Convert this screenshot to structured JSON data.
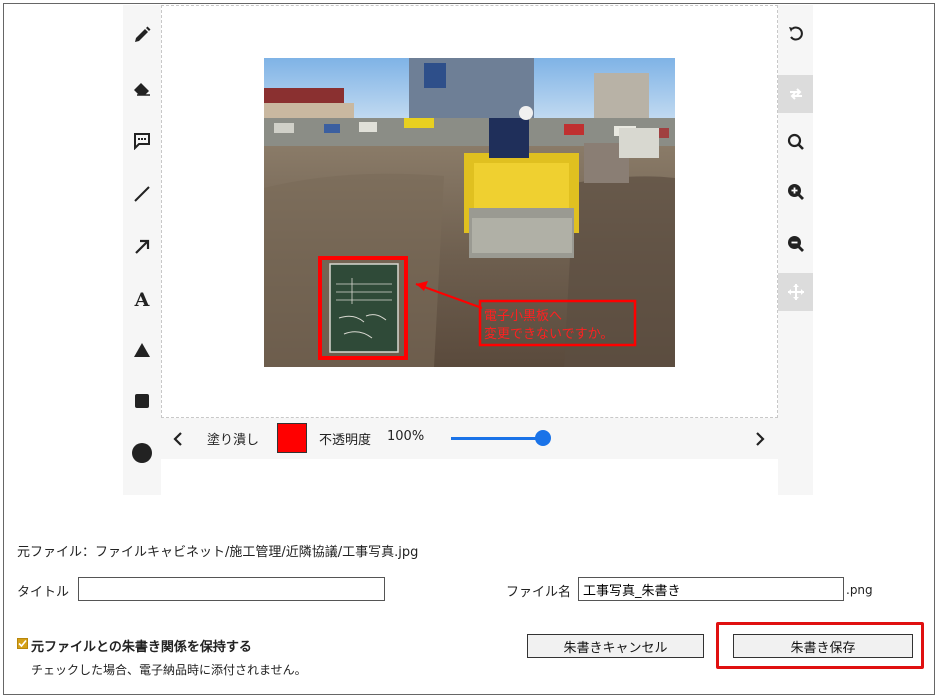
{
  "tools": {
    "left": [
      "pencil-icon",
      "eraser-icon",
      "comment-icon",
      "line-icon",
      "arrow-icon",
      "text-icon",
      "triangle-icon",
      "square-icon",
      "circle-icon"
    ],
    "text_tool_glyph": "A",
    "right": [
      "undo-icon",
      "redo-icon",
      "search-icon",
      "zoom-in-icon",
      "zoom-out-icon",
      "move-icon"
    ]
  },
  "photo": {
    "annotation_text_line1": "電子小黒板へ",
    "annotation_text_line2": "変更できないですか。",
    "annotation_color": "#ff0000"
  },
  "style_bar": {
    "fill_label": "塗り潰し",
    "fill_color": "#ff0000",
    "opacity_label": "不透明度",
    "opacity_value": "100%",
    "opacity_fraction": 1.0,
    "prev_icon": "chevron-left-icon",
    "next_icon": "chevron-right-icon"
  },
  "form": {
    "source_file": "元ファイル：ファイルキャビネット/施工管理/近隣協議/工事写真.jpg",
    "title_label": "タイトル",
    "title_value": "",
    "filename_label": "ファイル名",
    "filename_value": "工事写真_朱書き",
    "extension": ".png",
    "keep_relation_label": "元ファイルとの朱書き関係を保持する",
    "keep_relation_checked": true,
    "keep_relation_note": "チェックした場合、電子納品時に添付されません。"
  },
  "buttons": {
    "cancel_label": "朱書きキャンセル",
    "save_label": "朱書き保存"
  },
  "colors": {
    "accent": "#1a73e8",
    "highlight": "#e01010",
    "checkbox": "#d4a017"
  }
}
